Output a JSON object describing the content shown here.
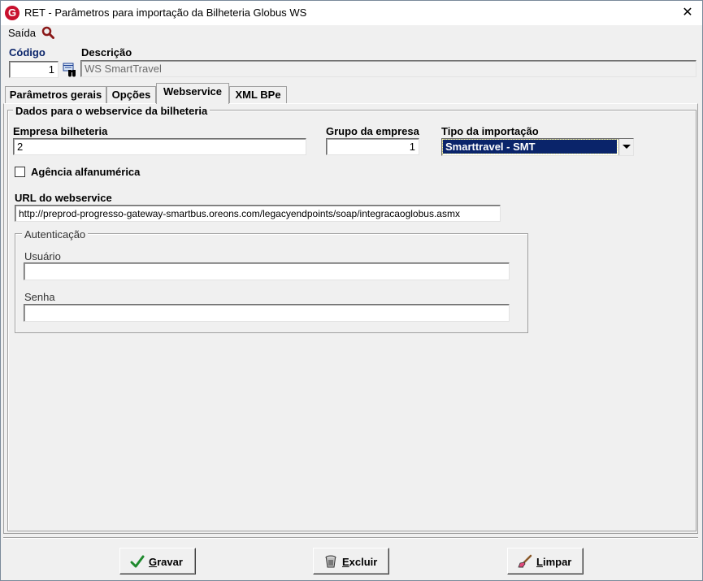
{
  "window": {
    "title": "RET - Parâmetros para importação da Bilheteria Globus WS",
    "logo_letter": "G",
    "close_glyph": "✕"
  },
  "menu": {
    "saida": "Saída"
  },
  "header": {
    "codigo_label": "Código",
    "codigo_value": "1",
    "descricao_label": "Descrição",
    "descricao_value": "WS SmartTravel"
  },
  "tabs": [
    {
      "label": "Parâmetros gerais",
      "active": false
    },
    {
      "label": "Opções",
      "active": false
    },
    {
      "label": "Webservice",
      "active": true
    },
    {
      "label": "XML BPe",
      "active": false
    }
  ],
  "webservice": {
    "group_title": "Dados para o webservice da bilheteria",
    "empresa_label": "Empresa bilheteria",
    "empresa_value": "2",
    "grupo_label": "Grupo da empresa",
    "grupo_value": "1",
    "tipo_label": "Tipo da importação",
    "tipo_value": "Smarttravel - SMT",
    "agencia_label": "Agência alfanumérica",
    "agencia_checked": false,
    "url_label": "URL do webservice",
    "url_value": "http://preprod-progresso-gateway-smartbus.oreons.com/legacyendpoints/soap/integracaoglobus.asmx",
    "auth": {
      "group_title": "Autenticação",
      "usuario_label": "Usuário",
      "usuario_value": "",
      "senha_label": "Senha",
      "senha_value": ""
    }
  },
  "buttons": {
    "gravar_first": "G",
    "gravar_rest": "ravar",
    "excluir_first": "E",
    "excluir_rest": "xcluir",
    "limpar_first": "L",
    "limpar_rest": "impar"
  },
  "colors": {
    "selection": "#0a246a",
    "label_blue": "#0a246a",
    "logo_red": "#c8102e"
  }
}
